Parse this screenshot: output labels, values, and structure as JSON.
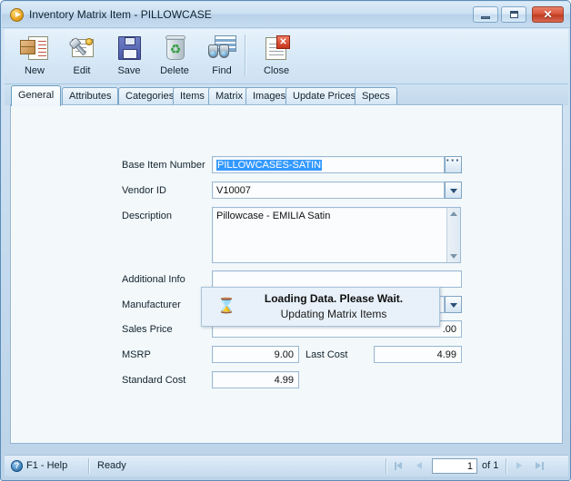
{
  "window": {
    "title": "Inventory Matrix Item - PILLOWCASE",
    "icon": "app-play-icon",
    "controls": {
      "minimize": "minimize-icon",
      "maximize": "maximize-icon",
      "close": "close-icon"
    }
  },
  "toolbar": {
    "buttons": [
      {
        "label": "New",
        "icon": "new-item-icon"
      },
      {
        "label": "Edit",
        "icon": "edit-wrench-icon"
      },
      {
        "label": "Save",
        "icon": "save-floppy-icon"
      },
      {
        "label": "Delete",
        "icon": "delete-recycle-bin-icon"
      },
      {
        "label": "Find",
        "icon": "find-binoculars-icon"
      },
      {
        "label": "Close",
        "icon": "close-document-icon"
      }
    ]
  },
  "tabs": [
    {
      "label": "General",
      "active": true
    },
    {
      "label": "Attributes",
      "active": false
    },
    {
      "label": "Categories",
      "active": false
    },
    {
      "label": "Items",
      "active": false
    },
    {
      "label": "Matrix",
      "active": false
    },
    {
      "label": "Images",
      "active": false
    },
    {
      "label": "Update Prices",
      "active": false
    },
    {
      "label": "Specs",
      "active": false
    }
  ],
  "form": {
    "base_item_number": {
      "label": "Base Item Number",
      "value": "PILLOWCASES-SATIN",
      "selected": true,
      "browse_button": "ellipsis-icon"
    },
    "vendor_id": {
      "label": "Vendor ID",
      "value": "V10007",
      "dropdown": "chevron-down-icon"
    },
    "description": {
      "label": "Description",
      "value": "Pillowcase - EMILIA Satin",
      "scrollbar": {
        "up": "scroll-up-arrow-icon",
        "down": "scroll-down-arrow-icon"
      }
    },
    "additional_info": {
      "label": "Additional Info",
      "value": ""
    },
    "manufacturer": {
      "label": "Manufacturer",
      "value": "",
      "dropdown": "chevron-down-icon"
    },
    "sales_price": {
      "label": "Sales Price",
      "value": ".00"
    },
    "msrp": {
      "label": "MSRP",
      "value": "9.00"
    },
    "last_cost": {
      "label": "Last Cost",
      "value": "4.99"
    },
    "standard_cost": {
      "label": "Standard Cost",
      "value": "4.99"
    }
  },
  "loading_dialog": {
    "icon": "hourglass-icon",
    "glyph": "⌛",
    "line1": "Loading Data. Please Wait.",
    "line2": "Updating Matrix Items"
  },
  "statusbar": {
    "help_icon": "help-question-icon",
    "help_label": "F1 - Help",
    "status": "Ready",
    "nav": {
      "first": "nav-first-icon",
      "prev": "nav-previous-icon",
      "next": "nav-next-icon",
      "last": "nav-last-icon",
      "page_value": "1",
      "page_total_label": "of 1"
    }
  },
  "colors": {
    "accent": "#3399ff",
    "frame": "#c5daee",
    "panel": "#f3f8fa",
    "close_red": "#c5331a"
  }
}
